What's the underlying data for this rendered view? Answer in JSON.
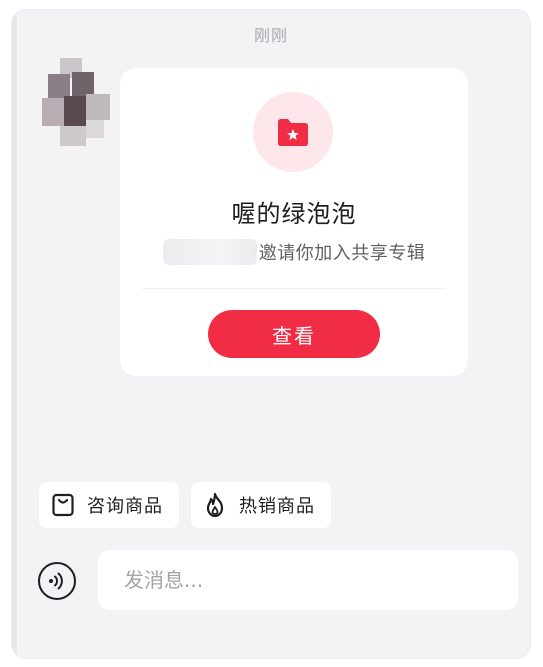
{
  "header": {
    "timestamp": "刚刚"
  },
  "message": {
    "sender_avatar": "avatar-pixelated",
    "card": {
      "icon": "folder-star-icon",
      "title": "喔的绿泡泡",
      "invite_text": "邀请你加入共享专辑",
      "view_label": "查看"
    }
  },
  "quick_actions": [
    {
      "icon": "shopping-bag-icon",
      "label": "咨询商品"
    },
    {
      "icon": "flame-icon",
      "label": "热销商品"
    }
  ],
  "composer": {
    "voice_icon": "voice-icon",
    "placeholder": "发消息..."
  },
  "colors": {
    "accent": "#f12d46",
    "badge_bg": "#fde7ea",
    "background": "#f3f3f5",
    "card": "#ffffff"
  }
}
